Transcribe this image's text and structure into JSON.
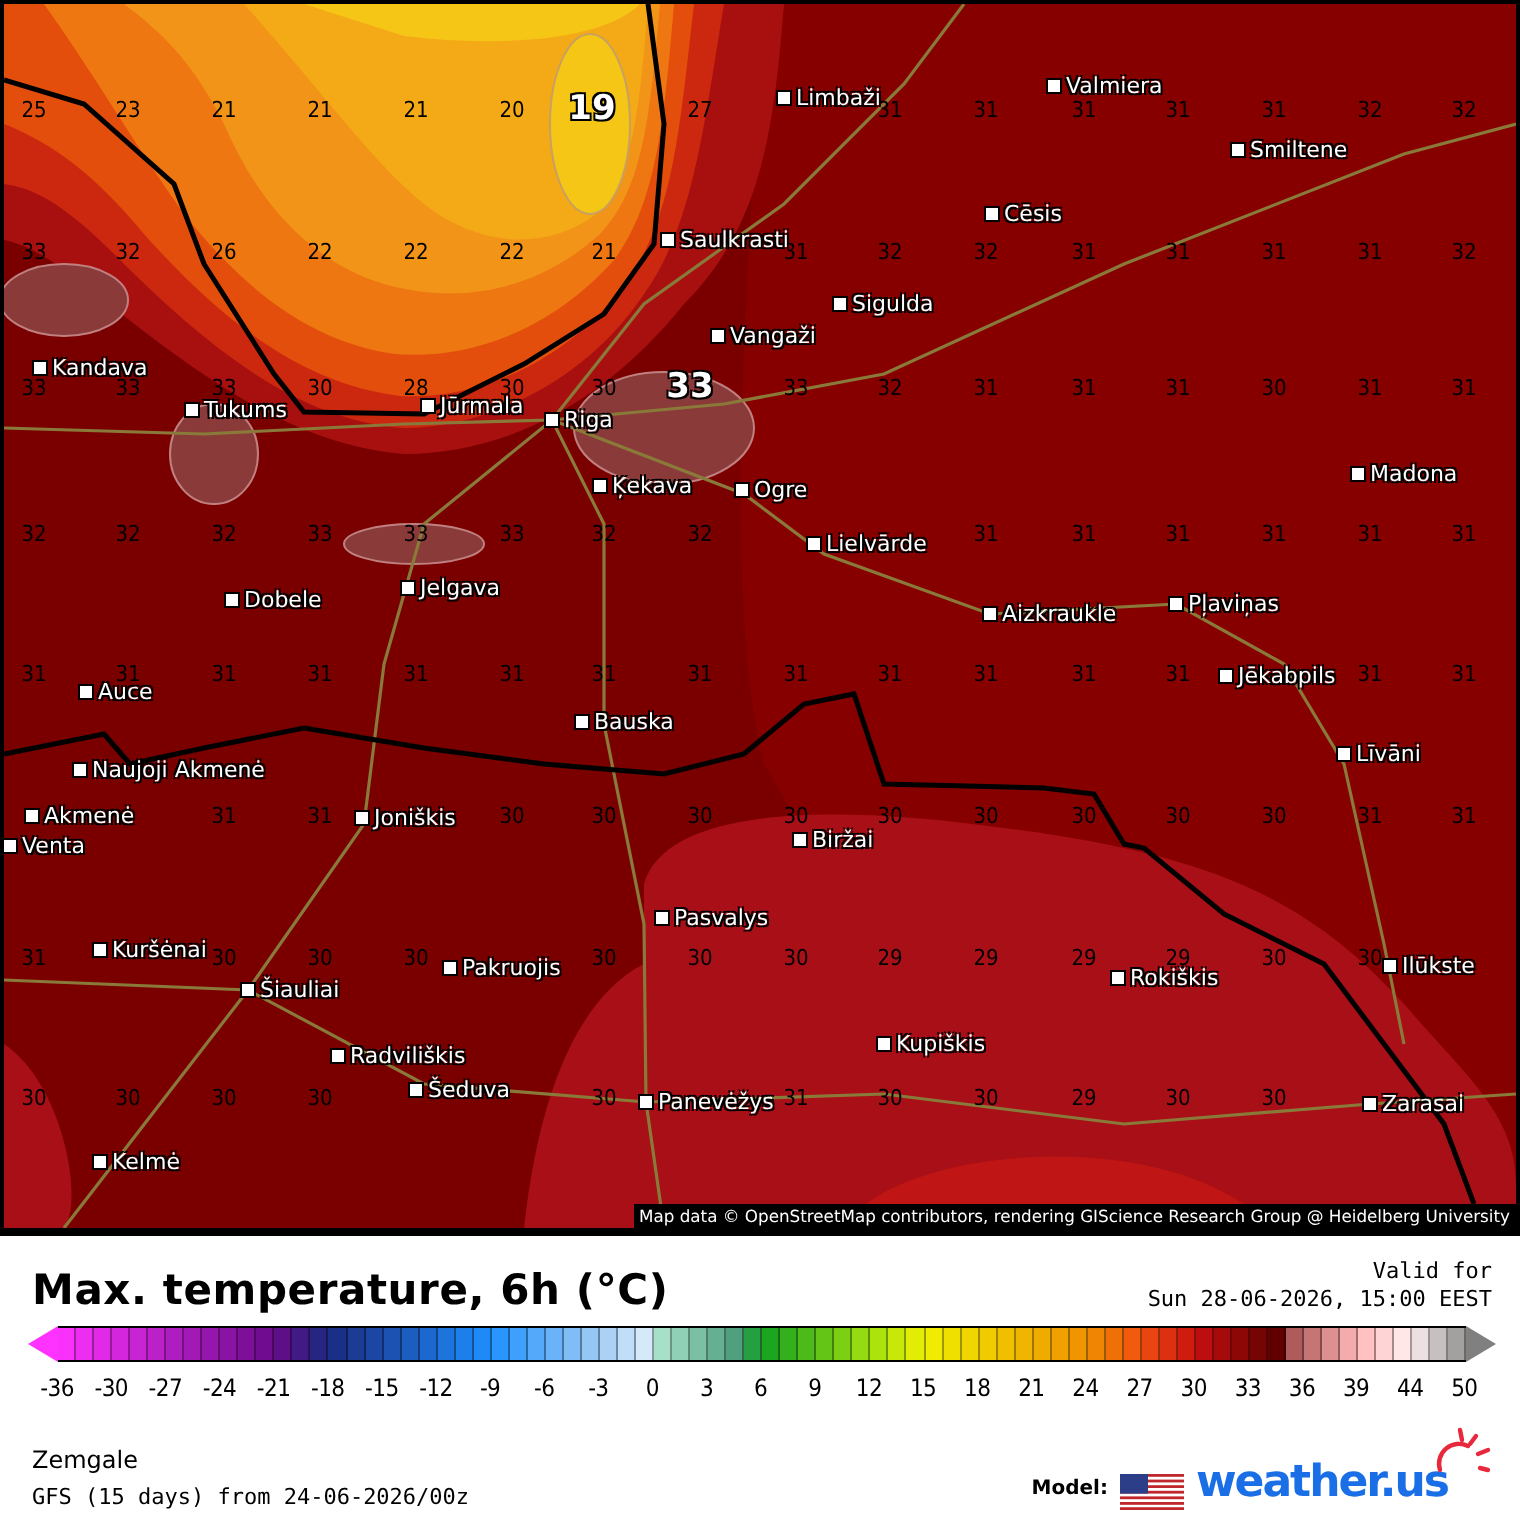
{
  "map": {
    "value_rows": [
      [
        "25",
        "23",
        "21",
        "21",
        "21",
        "20",
        null,
        "27",
        null,
        "31",
        "31",
        "31",
        "31",
        "31",
        "32",
        "32"
      ],
      [
        "33",
        "32",
        "26",
        "22",
        "22",
        "22",
        "21",
        null,
        "31",
        "32",
        "32",
        "31",
        "31",
        "31",
        "31",
        "32"
      ],
      [
        "33",
        "33",
        "33",
        "30",
        "28",
        "30",
        "30",
        null,
        "33",
        "32",
        "31",
        "31",
        "31",
        "30",
        "31",
        "31"
      ],
      [
        "32",
        "32",
        "32",
        "33",
        "33",
        "33",
        "32",
        "32",
        null,
        null,
        "31",
        "31",
        "31",
        "31",
        "31",
        "31"
      ],
      [
        "31",
        "31",
        "31",
        "31",
        "31",
        "31",
        "31",
        "31",
        "31",
        "31",
        "31",
        "31",
        "31",
        null,
        "31",
        "31"
      ],
      [
        null,
        null,
        "31",
        "31",
        null,
        "30",
        "30",
        "30",
        "30",
        "30",
        "30",
        "30",
        "30",
        "30",
        "31",
        "31"
      ],
      [
        "31",
        null,
        "30",
        "30",
        "30",
        null,
        "30",
        "30",
        "30",
        "29",
        "29",
        "29",
        "29",
        "30",
        "30",
        null
      ],
      [
        "30",
        "30",
        "30",
        "30",
        null,
        null,
        "30",
        null,
        "31",
        "30",
        "30",
        "29",
        "30",
        "30",
        null,
        null
      ]
    ],
    "extremes": [
      {
        "value": "19"
      },
      {
        "value": "33"
      }
    ],
    "cities": [
      {
        "name": "Limbaži"
      },
      {
        "name": "Valmiera"
      },
      {
        "name": "Smiltene"
      },
      {
        "name": "Cēsis"
      },
      {
        "name": "Saulkrasti"
      },
      {
        "name": "Sigulda"
      },
      {
        "name": "Vangaži"
      },
      {
        "name": "Kandava"
      },
      {
        "name": "Tukums"
      },
      {
        "name": "Jūrmala"
      },
      {
        "name": "Riga"
      },
      {
        "name": "Ķekava"
      },
      {
        "name": "Ogre"
      },
      {
        "name": "Lielvārde"
      },
      {
        "name": "Madona"
      },
      {
        "name": "Dobele"
      },
      {
        "name": "Jelgava"
      },
      {
        "name": "Aizkraukle"
      },
      {
        "name": "Pļaviņas"
      },
      {
        "name": "Auce"
      },
      {
        "name": "Jēkabpils"
      },
      {
        "name": "Bauska"
      },
      {
        "name": "Naujoji Akmenė"
      },
      {
        "name": "Līvāni"
      },
      {
        "name": "Akmenė"
      },
      {
        "name": "Joniškis"
      },
      {
        "name": "Venta"
      },
      {
        "name": "Biržai"
      },
      {
        "name": "Pasvalys"
      },
      {
        "name": "Kuršėnai"
      },
      {
        "name": "Pakruojis"
      },
      {
        "name": "Rokiškis"
      },
      {
        "name": "Ilūkste"
      },
      {
        "name": "Šiauliai"
      },
      {
        "name": "Radviliškis"
      },
      {
        "name": "Kupiškis"
      },
      {
        "name": "Šeduva"
      },
      {
        "name": "Panevėžys"
      },
      {
        "name": "Zarasai"
      },
      {
        "name": "Kelmė"
      }
    ],
    "attribution": "Map data © OpenStreetMap contributors, rendering GIScience Research Group @ Heidelberg University"
  },
  "legend": {
    "title": "Max. temperature, 6h (°C)",
    "valid_label": "Valid for",
    "valid_time": "Sun 28-06-2026, 15:00 EEST",
    "ticks": [
      "-36",
      "-30",
      "-27",
      "-24",
      "-21",
      "-18",
      "-15",
      "-12",
      "-9",
      "-6",
      "-3",
      "0",
      "3",
      "6",
      "9",
      "12",
      "15",
      "18",
      "21",
      "24",
      "27",
      "30",
      "33",
      "36",
      "39",
      "44",
      "50"
    ]
  },
  "footer": {
    "region": "Zemgale",
    "run": "GFS (15 days) from 24-06-2026/00z",
    "model_label": "Model:",
    "logo_text": "weather.us"
  }
}
